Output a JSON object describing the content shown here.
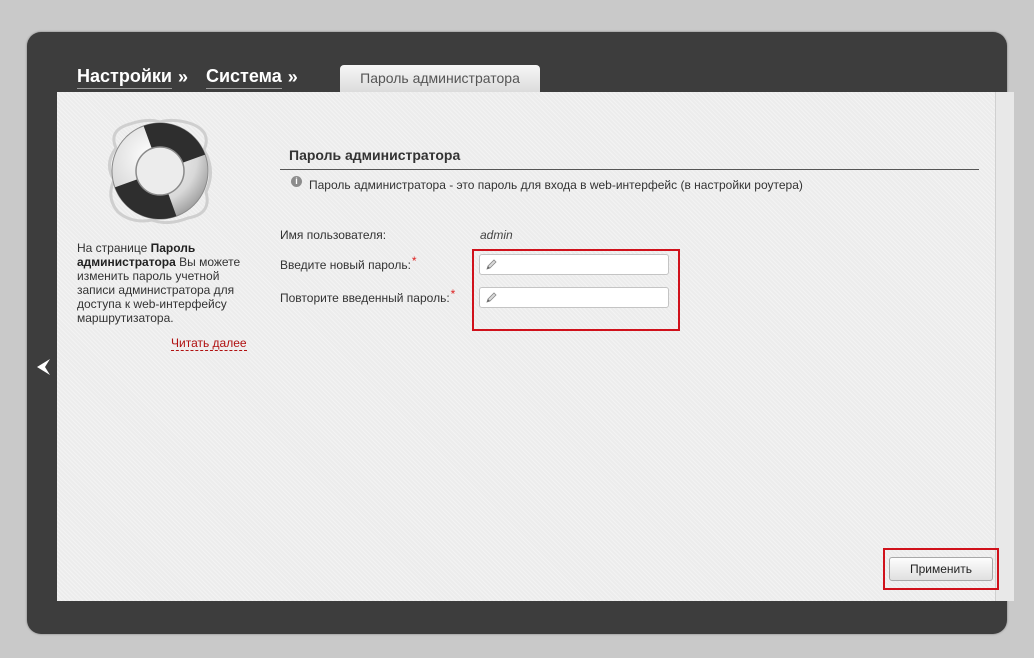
{
  "breadcrumb": {
    "items": [
      "Настройки",
      "Система"
    ],
    "separator": "»",
    "active_tab": "Пароль администратора"
  },
  "sidebar": {
    "help_prefix": "На странице ",
    "help_bold": "Пароль администратора",
    "help_suffix": " Вы можете изменить пароль учетной записи администратора для доступа к web-интерфейсу маршрутизатора.",
    "read_more": "Читать далее"
  },
  "section": {
    "title": "Пароль администратора",
    "info": "Пароль администратора - это пароль для входа в web-интерфейс (в настройки роутера)"
  },
  "form": {
    "username_label": "Имя пользователя:",
    "username_value": "admin",
    "new_password_label": "Введите новый пароль:",
    "confirm_password_label": "Повторите введенный пароль:",
    "required_mark": "*",
    "new_password_value": "",
    "confirm_password_value": ""
  },
  "actions": {
    "apply_label": "Применить"
  },
  "colors": {
    "frame": "#3d3d3d",
    "panel": "#ececec",
    "highlight": "#d0111b",
    "link": "#b01010"
  },
  "icons": [
    "lifebuoy-icon",
    "back-arrow-icon",
    "info-icon",
    "pencil-icon"
  ]
}
